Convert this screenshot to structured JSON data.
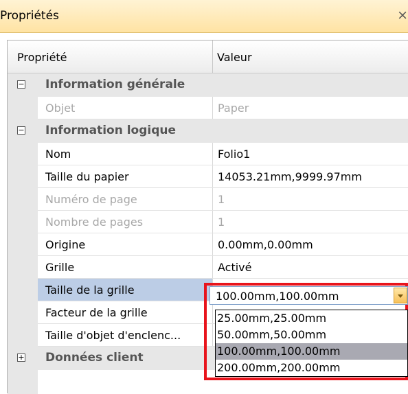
{
  "panel": {
    "title": "Propriétés",
    "close": "×"
  },
  "header": {
    "property": "Propriété",
    "value": "Valeur"
  },
  "categories": {
    "general": {
      "label": "Information générale",
      "expander": "−"
    },
    "logical": {
      "label": "Information logique",
      "expander": "−"
    },
    "client": {
      "label": "Données client",
      "expander": "+"
    }
  },
  "rows": {
    "objet": {
      "name": "Objet",
      "value": "Paper"
    },
    "nom": {
      "name": "Nom",
      "value": "Folio1"
    },
    "taille_papier": {
      "name": "Taille du papier",
      "value": "14053.21mm,9999.97mm"
    },
    "numero_page": {
      "name": "Numéro de page",
      "value": "1"
    },
    "nombre_pages": {
      "name": "Nombre de pages",
      "value": "1"
    },
    "origine": {
      "name": "Origine",
      "value": "0.00mm,0.00mm"
    },
    "grille": {
      "name": "Grille",
      "value": "Activé"
    },
    "taille_grille": {
      "name": "Taille de la grille",
      "value": "100.00mm,100.00mm"
    },
    "facteur_grille": {
      "name": "Facteur de la grille"
    },
    "taille_objet": {
      "name": "Taille d'objet d'enclenc..."
    }
  },
  "dropdown": {
    "options": [
      "25.00mm,25.00mm",
      "50.00mm,50.00mm",
      "100.00mm,100.00mm",
      "200.00mm,200.00mm"
    ],
    "selected_index": 2
  },
  "colors": {
    "highlight_border": "#e8141c",
    "selected_row": "#bccde6",
    "title_bar": "#ffe3a3"
  }
}
